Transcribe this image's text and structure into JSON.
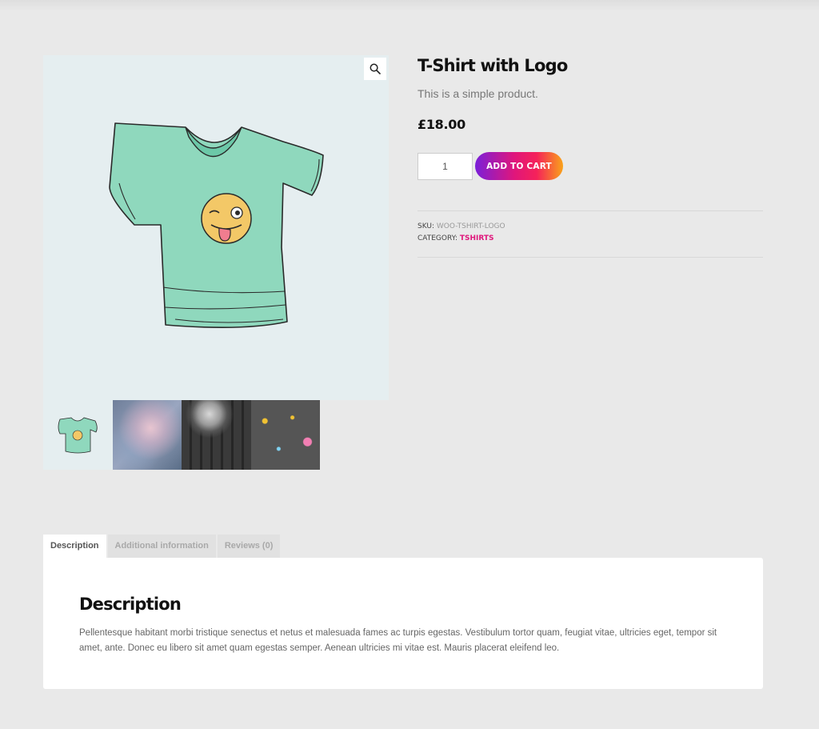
{
  "product": {
    "title": "T-Shirt with Logo",
    "short_description": "This is a simple product.",
    "price": "£18.00",
    "quantity": "1",
    "add_to_cart_label": "ADD TO CART",
    "sku_label": "SKU:",
    "sku_value": "WOO-TSHIRT-LOGO",
    "category_label": "CATEGORY:",
    "category_value": "TSHIRTS"
  },
  "gallery": {
    "zoom_icon": "magnifier-icon",
    "thumbnails": [
      "tshirt-logo",
      "nebula-sky",
      "dj-turntable",
      "confetti-dark"
    ]
  },
  "tabs": [
    {
      "label": "Description",
      "active": true
    },
    {
      "label": "Additional information",
      "active": false
    },
    {
      "label": "Reviews (0)",
      "active": false
    }
  ],
  "description": {
    "heading": "Description",
    "text": "Pellentesque habitant morbi tristique senectus et netus et malesuada fames ac turpis egestas. Vestibulum tortor quam, feugiat vitae, ultricies eget, tempor sit amet, ante. Donec eu libero sit amet quam egestas semper. Aenean ultricies mi vitae est. Mauris placerat eleifend leo."
  },
  "colors": {
    "accent": "#e0167b",
    "button_gradient": [
      "#7a1fd9",
      "#e0167b",
      "#f9a31a"
    ],
    "page_background": "#e9e9e9"
  }
}
